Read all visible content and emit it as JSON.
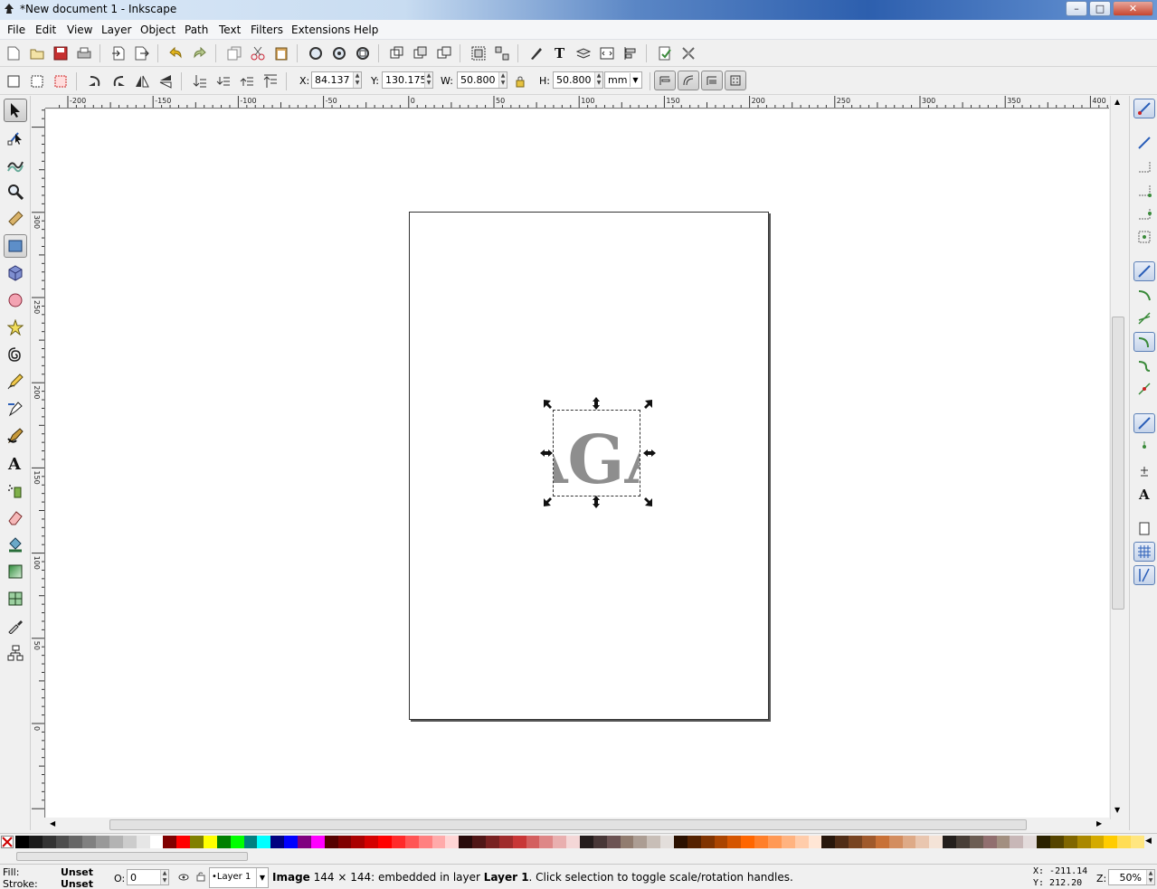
{
  "window": {
    "title": "*New document 1 - Inkscape",
    "minimize": "–",
    "maximize": "□",
    "close": "✕"
  },
  "menu": [
    "File",
    "Edit",
    "View",
    "Layer",
    "Object",
    "Path",
    "Text",
    "Filters",
    "Extensions",
    "Help"
  ],
  "tool_controls": {
    "x_label": "X:",
    "x_value": "84.137",
    "y_label": "Y:",
    "y_value": "130.175",
    "w_label": "W:",
    "w_value": "50.800",
    "h_label": "H:",
    "h_value": "50.800",
    "unit": "mm"
  },
  "rulers": {
    "top_ticks": [
      "-200",
      "-150",
      "-100",
      "-50",
      "0",
      "50",
      "100",
      "150",
      "200",
      "250",
      "300",
      "350",
      "400"
    ],
    "left_ticks": [
      "0",
      "50",
      "100",
      "150",
      "200",
      "250",
      "300"
    ]
  },
  "canvas": {
    "selected_image_text": "AGA",
    "image_color": "#8e8e8e"
  },
  "palette_colors": [
    "#000000",
    "#1a1a1a",
    "#333333",
    "#4d4d4d",
    "#666666",
    "#808080",
    "#999999",
    "#b3b3b3",
    "#cccccc",
    "#e6e6e6",
    "#ffffff",
    "#800000",
    "#ff0000",
    "#808000",
    "#ffff00",
    "#008000",
    "#00ff00",
    "#008080",
    "#00ffff",
    "#000080",
    "#0000ff",
    "#800080",
    "#ff00ff",
    "#550000",
    "#800000",
    "#aa0000",
    "#d40000",
    "#ff0000",
    "#ff2a2a",
    "#ff5555",
    "#ff8080",
    "#ffaaaa",
    "#ffd5d5",
    "#280b0b",
    "#501616",
    "#782121",
    "#a02c2c",
    "#c83737",
    "#d35f5f",
    "#de8787",
    "#e9afaf",
    "#f4d7d7",
    "#241c1c",
    "#483737",
    "#6c5353",
    "#917c6f",
    "#ac9d93",
    "#c8beb7",
    "#e3dedb",
    "#2b1100",
    "#552200",
    "#803300",
    "#aa4400",
    "#d45500",
    "#ff6600",
    "#ff7f2a",
    "#ff9955",
    "#ffb380",
    "#ffccaa",
    "#ffe6d5",
    "#28170b",
    "#502d16",
    "#784421",
    "#a05a2c",
    "#c87137",
    "#d38d5f",
    "#deaa87",
    "#e9c6af",
    "#f4e3d7",
    "#241f1c",
    "#483e37",
    "#6c5d53",
    "#916f6f",
    "#a28f80",
    "#c8b7b7",
    "#e3dbdb",
    "#2b2200",
    "#554400",
    "#806600",
    "#aa8800",
    "#d4aa00",
    "#ffcc00",
    "#ffdd55",
    "#ffe680"
  ],
  "status": {
    "fill_label": "Fill:",
    "fill_value": "Unset",
    "stroke_label": "Stroke:",
    "stroke_value": "Unset",
    "opacity_label": "O:",
    "opacity_value": "0",
    "layer": "•Layer 1",
    "message_bold": "Image",
    "message_mid": " 144 × 144: embedded in layer ",
    "message_layer": "Layer 1",
    "message_end": ". Click selection to toggle scale/rotation handles.",
    "cursor_x": "X: -211.14",
    "cursor_y": "Y:  212.20",
    "zoom_label": "Z:",
    "zoom_value": "50%"
  }
}
